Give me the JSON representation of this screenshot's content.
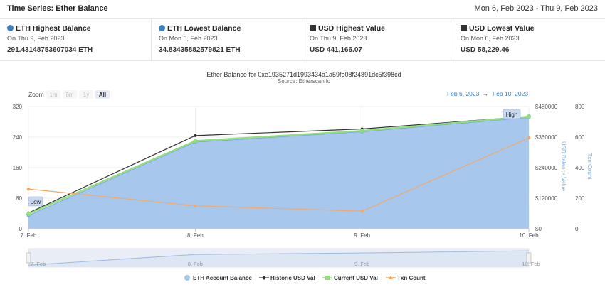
{
  "header": {
    "title": "Time Series: Ether Balance",
    "date_range": "Mon 6, Feb 2023 - Thu 9, Feb 2023"
  },
  "cards": [
    {
      "title": "ETH Highest Balance",
      "sub": "On Thu 9, Feb 2023",
      "value": "291.43148753607034 ETH",
      "icon": "circle"
    },
    {
      "title": "ETH Lowest Balance",
      "sub": "On Mon 6, Feb 2023",
      "value": "34.83435882579821 ETH",
      "icon": "circle"
    },
    {
      "title": "USD Highest Value",
      "sub": "On Thu 9, Feb 2023",
      "value": "USD 441,166.07",
      "icon": "square"
    },
    {
      "title": "USD Lowest Value",
      "sub": "On Mon 6, Feb 2023",
      "value": "USD 58,229.46",
      "icon": "square"
    }
  ],
  "chart": {
    "title": "Ether Balance for 0xe1935271d1993434a1a59fe08f24891dc5f398cd",
    "source": "Source: Etherscan.io",
    "zoom_label": "Zoom",
    "zoom_buttons": [
      "1m",
      "6m",
      "1y",
      "All"
    ],
    "range_from": "Feb 6, 2023",
    "range_arrow": "→",
    "range_to": "Feb 10, 2023",
    "high_label": "High",
    "low_label": "Low",
    "right_axis1_title": "USD Balance Value",
    "right_axis2_title": "Txn Count",
    "legend": [
      "ETH Account Balance",
      "Historic USD Val",
      "Current USD Val",
      "Txn Count"
    ]
  },
  "colors": {
    "area": "#a3c4ec",
    "historic": "#333333",
    "current": "#90e07a",
    "txn": "#f5a865",
    "accent": "#3d7fbf"
  },
  "chart_data": {
    "type": "area",
    "x": [
      "7. Feb",
      "8. Feb",
      "9. Feb",
      "10. Feb"
    ],
    "series": [
      {
        "name": "ETH Account Balance",
        "type": "area",
        "axis": "left",
        "values": [
          34.8,
          227,
          254,
          291.4
        ]
      },
      {
        "name": "Historic USD Val",
        "type": "line",
        "axis": "usd",
        "values": [
          62000,
          366000,
          392000,
          441166
        ]
      },
      {
        "name": "Current USD Val",
        "type": "line",
        "axis": "usd",
        "values": [
          58229,
          345000,
          385000,
          441166
        ]
      },
      {
        "name": "Txn Count",
        "type": "line",
        "axis": "txn",
        "values": [
          260,
          150,
          115,
          595
        ]
      }
    ],
    "left_axis": {
      "ylim": [
        0,
        320
      ],
      "ticks": [
        "0",
        "80",
        "160",
        "240",
        "320"
      ]
    },
    "usd_axis": {
      "title": "USD Balance Value",
      "ylim": [
        0,
        480000
      ],
      "ticks": [
        "$0",
        "$120000",
        "$240000",
        "$360000",
        "$480000"
      ]
    },
    "txn_axis": {
      "title": "Txn Count",
      "ylim": [
        0,
        800
      ],
      "ticks": [
        "0",
        "200",
        "400",
        "600",
        "800"
      ]
    },
    "navigator": {
      "x": [
        "7. Feb",
        "8. Feb",
        "9. Feb",
        "10. Feb"
      ],
      "values": [
        34.8,
        227,
        254,
        291.4
      ]
    }
  }
}
